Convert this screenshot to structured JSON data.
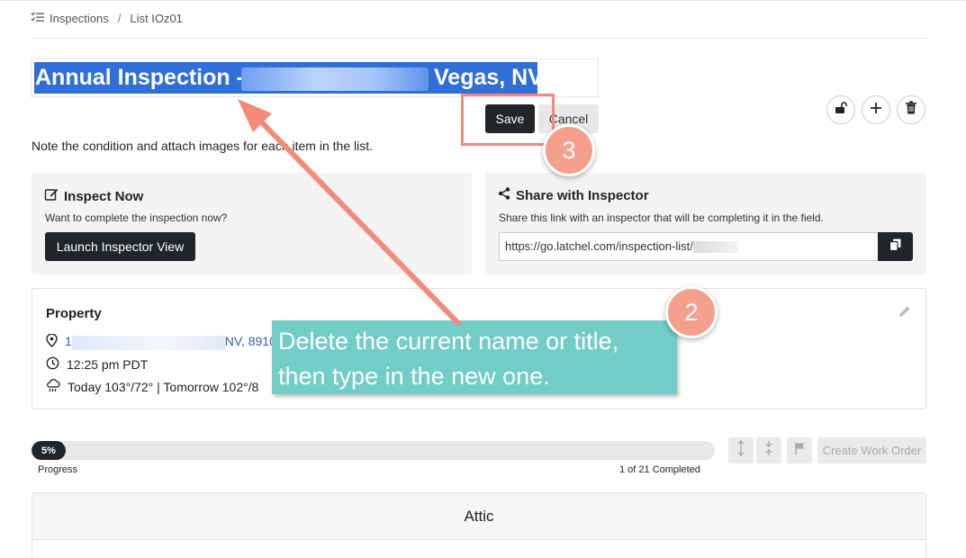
{
  "breadcrumb": {
    "items": [
      "Inspections",
      "List IOz01"
    ],
    "separator": "/"
  },
  "title": {
    "prefix": "Annual Inspection - 1",
    "suffix": "Vegas, NV"
  },
  "actions": {
    "save": "Save",
    "cancel": "Cancel"
  },
  "note": "Note the condition and attach images for each item in the list.",
  "inspect_now": {
    "heading": "Inspect Now",
    "description": "Want to complete the inspection now?",
    "button": "Launch Inspector View"
  },
  "share": {
    "heading": "Share with Inspector",
    "description": "Share this link with an inspector that will be completing it in the field.",
    "link": "https://go.latchel.com/inspection-list/"
  },
  "property": {
    "heading": "Property",
    "address_start": "1",
    "address_end": "NV, 8910",
    "time": "12:25 pm PDT",
    "weather": "Today 103°/72° | Tomorrow 102°/8"
  },
  "annotations": {
    "tooltip_line1": "Delete the current name or title,",
    "tooltip_line2": "then type in the new one.",
    "badge_2": "2",
    "badge_3": "3"
  },
  "progress": {
    "value_percent": 5,
    "badge_text": "5%",
    "label": "Progress",
    "completed": "1 of 21 Completed"
  },
  "toolbar": {
    "create_work_order": "Create Work Order"
  },
  "section": {
    "title": "Attic"
  },
  "colors": {
    "accent_dark": "#212529",
    "highlight": "#f48b7a",
    "tooltip": "#72cdc7",
    "selection": "#2f6fd6"
  }
}
